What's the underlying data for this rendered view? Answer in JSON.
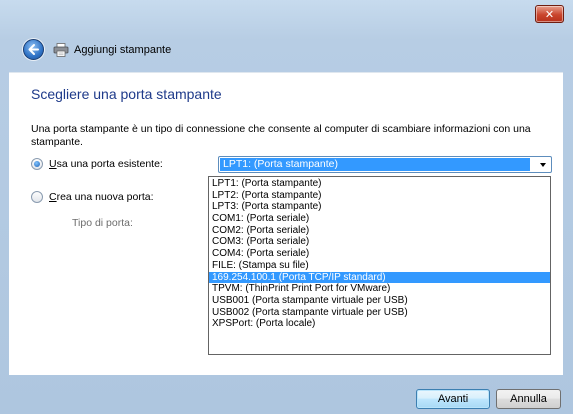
{
  "window": {
    "title": "Aggiungi stampante",
    "close_label": "✕"
  },
  "page": {
    "heading": "Scegliere una porta stampante",
    "description": "Una porta stampante è un tipo di connessione che consente al computer di scambiare informazioni con una stampante."
  },
  "options": {
    "existing_port": {
      "mnemonic": "U",
      "label_rest": "sa una porta esistente:",
      "checked": true
    },
    "new_port": {
      "mnemonic": "C",
      "label_rest": "rea una nuova porta:",
      "checked": false
    },
    "port_type_label": "Tipo di porta:"
  },
  "port_select": {
    "value": "LPT1: (Porta stampante)",
    "options": [
      "LPT1: (Porta stampante)",
      "LPT2: (Porta stampante)",
      "LPT3: (Porta stampante)",
      "COM1: (Porta seriale)",
      "COM2: (Porta seriale)",
      "COM3: (Porta seriale)",
      "COM4: (Porta seriale)",
      "FILE: (Stampa su file)",
      "169.254.100.1 (Porta TCP/IP standard)",
      "TPVM: (ThinPrint Print Port for VMware)",
      "USB001 (Porta stampante virtuale per USB)",
      "USB002 (Porta stampante virtuale per USB)",
      "XPSPort: (Porta locale)"
    ],
    "highlighted_index": 8
  },
  "buttons": {
    "next": "Avanti",
    "cancel": "Annulla"
  },
  "icons": {
    "back": "back-arrow-icon",
    "printer": "printer-icon",
    "close": "close-icon",
    "dropdown": "chevron-down-icon"
  }
}
